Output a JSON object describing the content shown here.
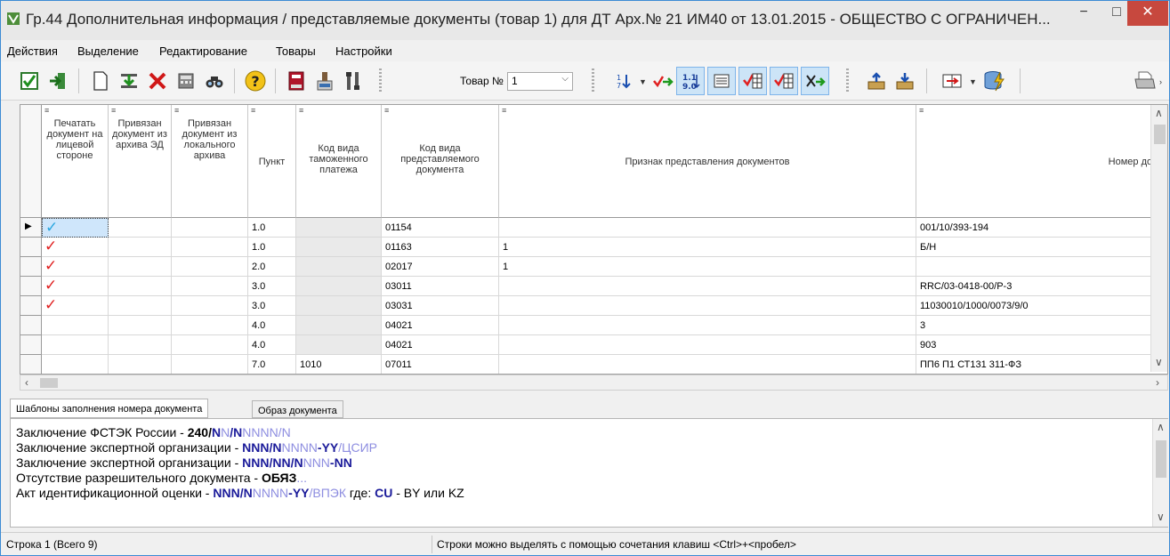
{
  "window": {
    "title": "Гр.44 Дополнительная информация / представляемые документы (товар 1) для  ДТ Арх.№ 21 ИМ40 от 13.01.2015 - ОБЩЕСТВО С ОГРАНИЧЕН...",
    "minimize": "−",
    "maximize": "□",
    "close": "✕"
  },
  "menu": [
    "Действия",
    "Выделение",
    "Редактирование",
    "Товары",
    "Настройки"
  ],
  "toolbar": {
    "item_label": "Товар №",
    "item_value": "1",
    "icons": [
      "checkbox-icon",
      "exit-icon",
      "new-document-icon",
      "insert-down-icon",
      "delete-icon",
      "calculator-icon",
      "find-icon",
      "help-icon",
      "book-icon",
      "document-stamp-icon",
      "tools-icon",
      "sort-icon",
      "checkmark-arrow-icon",
      "numbering-icon",
      "list-icon",
      "check-grid-icon",
      "check-grid-alt-icon",
      "cross-arrow-icon",
      "upload-icon",
      "download-icon",
      "transfer-icon",
      "database-icon",
      "printer-icon"
    ]
  },
  "grid": {
    "filter_glyph": "≡",
    "columns": [
      "Печатать документ на лицевой стороне",
      "Привязан документ из архива ЭД",
      "Привязан документ из локального архива",
      "Пункт",
      "Код вида таможенного платежа",
      "Код вида представляемого документа",
      "Признак представления документов",
      "Номер докум"
    ],
    "rows": [
      {
        "print": "✓",
        "print_color": "#2aa7e0",
        "item": "1.0",
        "pay_code": "",
        "doc_code": "01154",
        "sign": "",
        "number": "001/10/393-194",
        "current": true
      },
      {
        "print": "✓",
        "print_color": "#e02020",
        "item": "1.0",
        "pay_code": "",
        "doc_code": "01163",
        "sign": "1",
        "number": "Б/Н"
      },
      {
        "print": "✓",
        "print_color": "#e02020",
        "item": "2.0",
        "pay_code": "",
        "doc_code": "02017",
        "sign": "1",
        "number": ""
      },
      {
        "print": "✓",
        "print_color": "#e02020",
        "item": "3.0",
        "pay_code": "",
        "doc_code": "03011",
        "sign": "",
        "number": "RRC/03-0418-00/P-3"
      },
      {
        "print": "✓",
        "print_color": "#e02020",
        "item": "3.0",
        "pay_code": "",
        "doc_code": "03031",
        "sign": "",
        "number": "11030010/1000/0073/9/0"
      },
      {
        "print": "",
        "print_color": "",
        "item": "4.0",
        "pay_code": "",
        "doc_code": "04021",
        "sign": "",
        "number": "3"
      },
      {
        "print": "",
        "print_color": "",
        "item": "4.0",
        "pay_code": "",
        "doc_code": "04021",
        "sign": "",
        "number": "903"
      },
      {
        "print": "",
        "print_color": "",
        "item": "7.0",
        "pay_code": "1010",
        "doc_code": "07011",
        "sign": "",
        "number": "ПП6  П1  СТ131 311-ФЗ"
      }
    ]
  },
  "tabs": [
    "Шаблоны заполнения номера документа",
    "Образ документа"
  ],
  "templates": [
    {
      "label": "Заключение ФСТЭК России - ",
      "parts": [
        [
          "bold",
          "240/"
        ],
        [
          "dark",
          "N"
        ],
        [
          "light",
          "N"
        ],
        [
          "dark",
          "/N"
        ],
        [
          "light",
          "NNNN/N"
        ]
      ]
    },
    {
      "label": "Заключение экспертной организации - ",
      "parts": [
        [
          "dark",
          "NNN/N"
        ],
        [
          "light",
          "NNNN"
        ],
        [
          "dark",
          "-YY"
        ],
        [
          "light",
          "/ЦСИР"
        ]
      ]
    },
    {
      "label": "Заключение экспертной организации - ",
      "parts": [
        [
          "dark",
          "NNN/NN/N"
        ],
        [
          "light",
          "NNN"
        ],
        [
          "dark",
          "-NN"
        ]
      ]
    },
    {
      "label": "Отсутствие разрешительного документа - ",
      "parts": [
        [
          "bold",
          "ОБЯЗ"
        ],
        [
          "light",
          "..."
        ]
      ]
    },
    {
      "label": "Акт идентификационной оценки - ",
      "parts": [
        [
          "dark",
          "NNN/N"
        ],
        [
          "light",
          "NNNN"
        ],
        [
          "dark",
          "-YY"
        ],
        [
          "light",
          "/ВПЭК"
        ],
        [
          "plain",
          "  где: "
        ],
        [
          "dark",
          "CU"
        ],
        [
          "plain",
          " - BY или KZ"
        ]
      ]
    }
  ],
  "status": {
    "left": "Строка 1 (Всего 9)",
    "right": "Строки можно выделять с помощью сочетания клавиш <Ctrl>+<пробел>"
  },
  "colors": {
    "accent": "#3c8bd4",
    "check_red": "#e02020",
    "check_blue": "#2aa7e0",
    "tpl_dark": "#1b1b9a",
    "tpl_light": "#8d8de0"
  }
}
